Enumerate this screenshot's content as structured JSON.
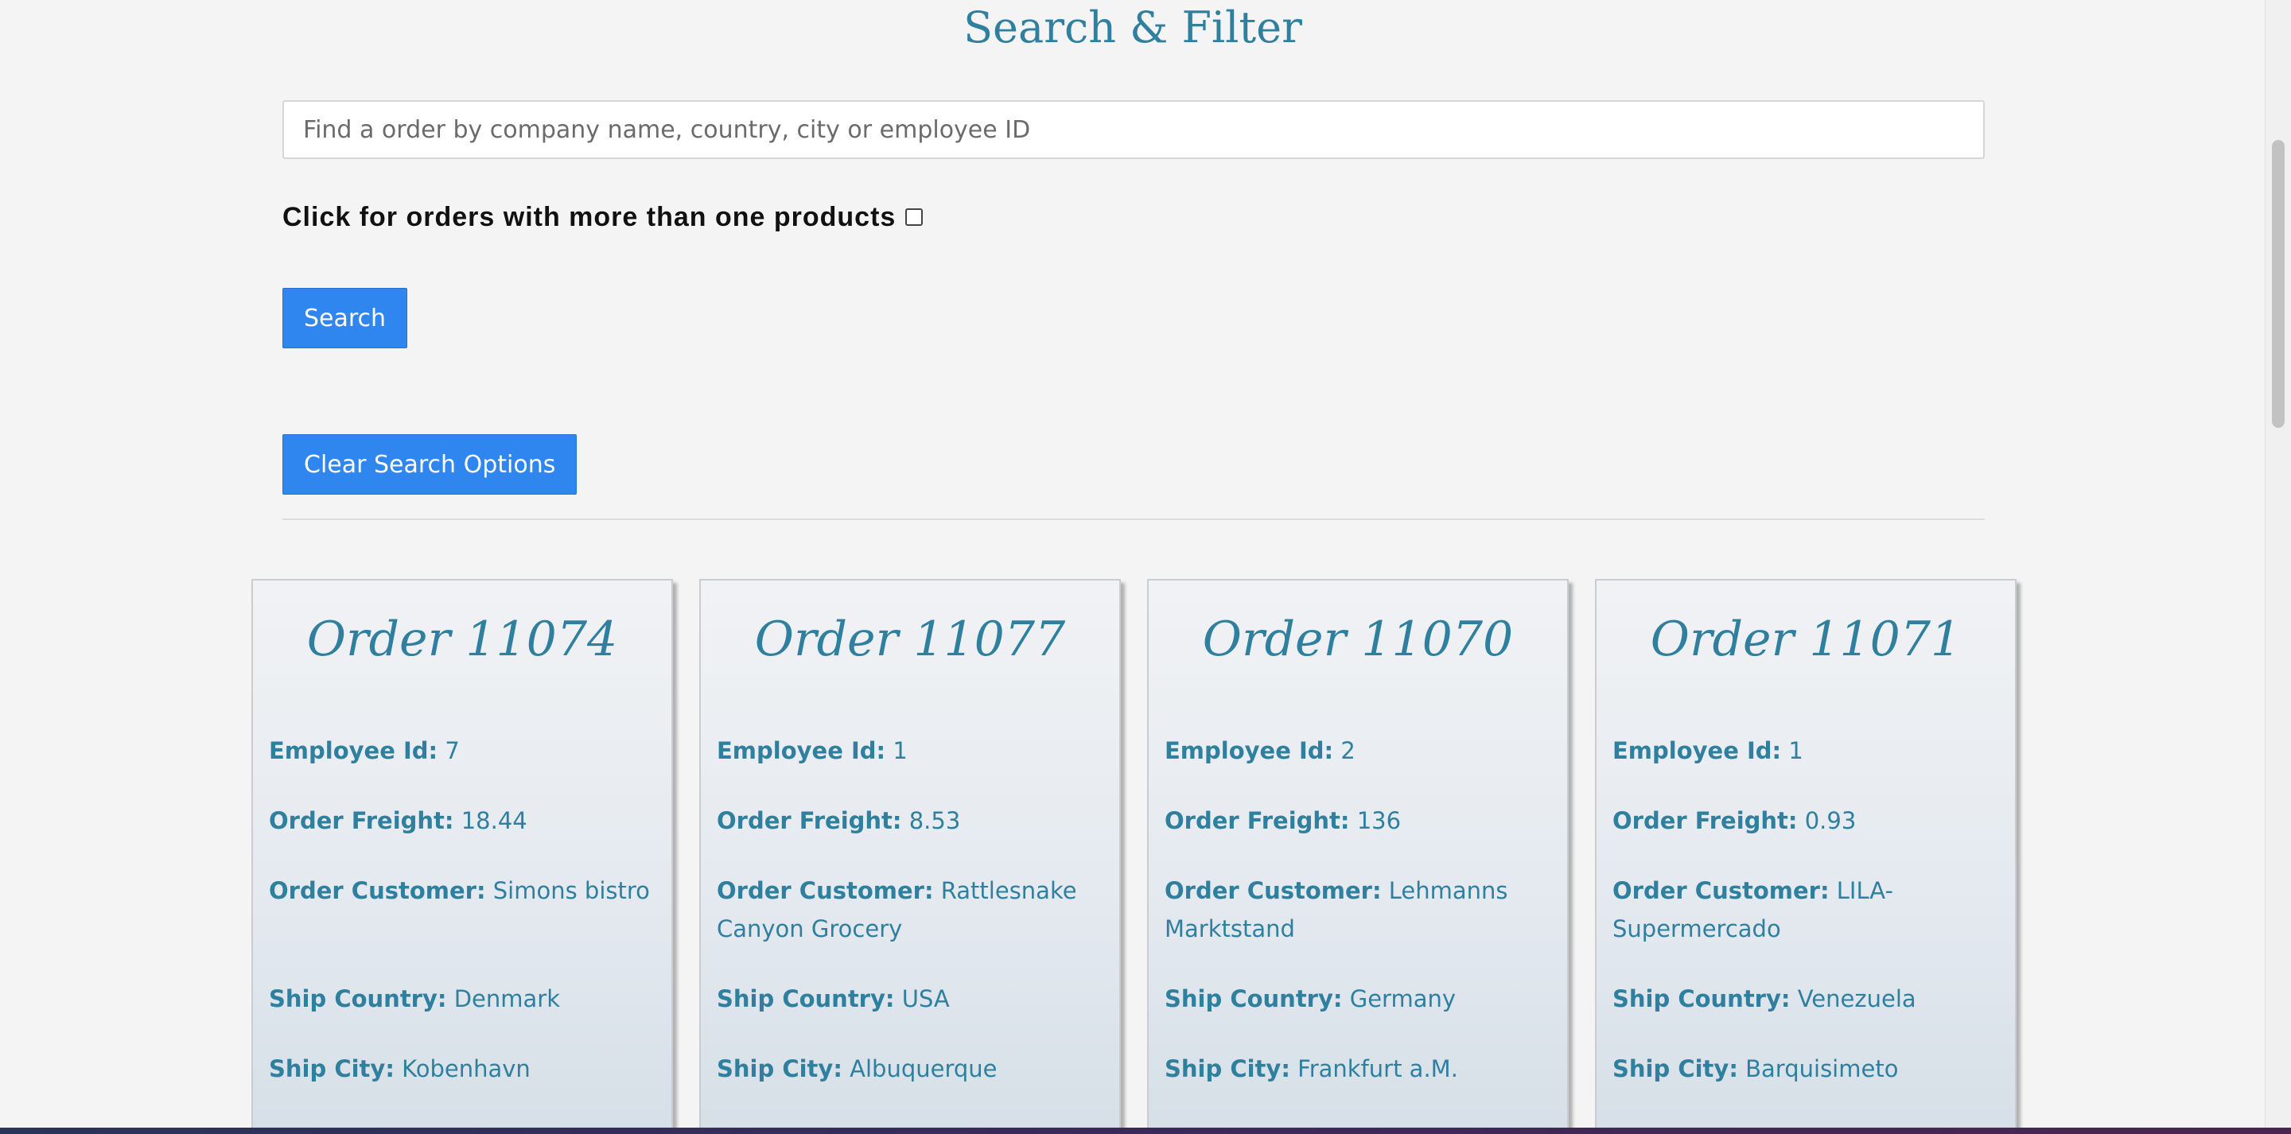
{
  "header": {
    "title": "Search & Filter"
  },
  "search": {
    "placeholder": "Find a order by company name, country, city or employee ID",
    "value": ""
  },
  "filter": {
    "label": "Click for orders with more than one products",
    "checked": false
  },
  "buttons": {
    "search_label": "Search",
    "clear_label": "Clear Search Options"
  },
  "field_labels": {
    "employee_id": "Employee Id:",
    "order_freight": "Order Freight:",
    "order_customer": "Order Customer:",
    "ship_country": "Ship Country:",
    "ship_city": "Ship City:"
  },
  "orders": [
    {
      "title": "Order 11074",
      "employee_id": "7",
      "order_freight": "18.44",
      "order_customer": "Simons bistro",
      "ship_country": "Denmark",
      "ship_city": "Kobenhavn"
    },
    {
      "title": "Order 11077",
      "employee_id": "1",
      "order_freight": "8.53",
      "order_customer": "Rattlesnake Canyon Grocery",
      "ship_country": "USA",
      "ship_city": "Albuquerque"
    },
    {
      "title": "Order 11070",
      "employee_id": "2",
      "order_freight": "136",
      "order_customer": "Lehmanns Marktstand",
      "ship_country": "Germany",
      "ship_city": "Frankfurt a.M."
    },
    {
      "title": "Order 11071",
      "employee_id": "1",
      "order_freight": "0.93",
      "order_customer": "LILA-Supermercado",
      "ship_country": "Venezuela",
      "ship_city": "Barquisimeto"
    }
  ],
  "colors": {
    "accent": "#2f7f9f",
    "button": "#2f86ee",
    "background": "#f4f4f4"
  }
}
